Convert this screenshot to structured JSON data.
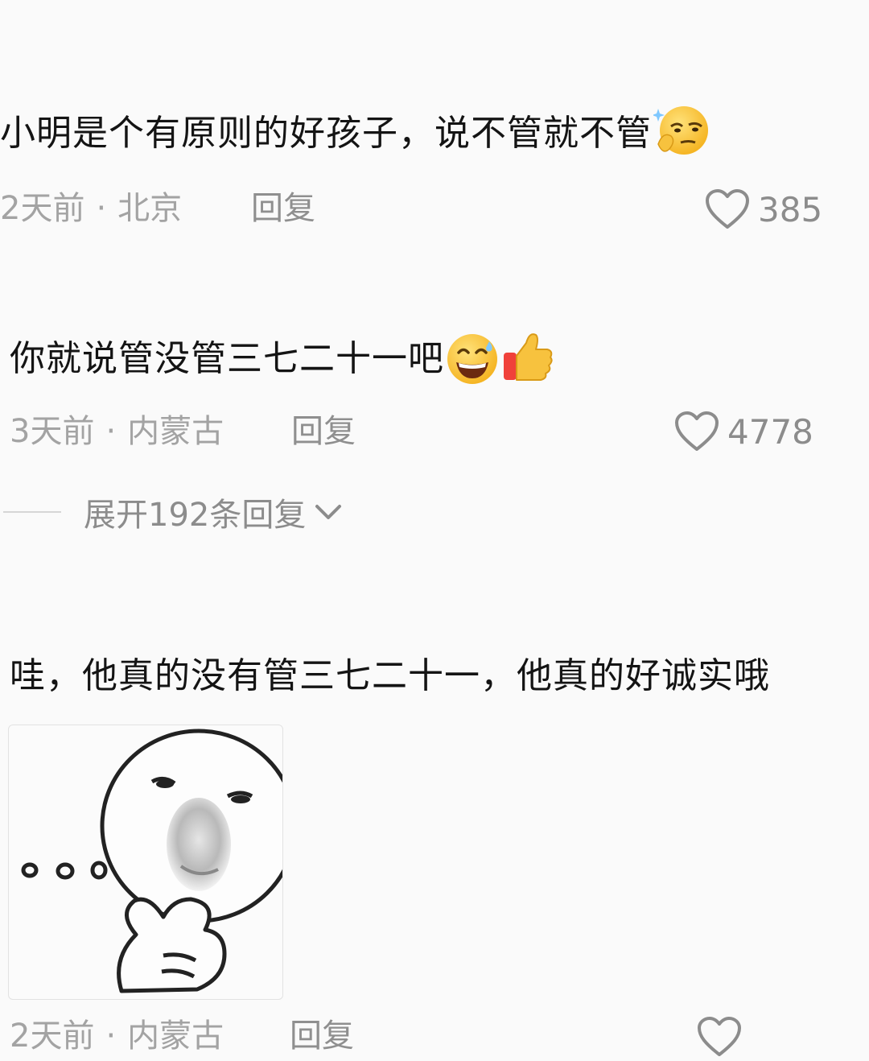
{
  "comments": [
    {
      "text": "小明是个有原则的好孩子，说不管就不管",
      "emoji": "smirk-thinking-emoji",
      "time": "2天前",
      "location": "北京",
      "reply_label": "回复",
      "likes": "385"
    },
    {
      "text": "你就说管没管三七二十一吧",
      "emojis": [
        "grinning-sweat-emoji",
        "thumbs-up-emoji"
      ],
      "time": "3天前",
      "location": "内蒙古",
      "reply_label": "回复",
      "likes": "4778",
      "expand_label": "展开192条回复"
    },
    {
      "text": "哇，他真的没有管三七二十一，他真的好诚实哦",
      "sticker": "thinking-face-meme-sticker",
      "time": "2天前",
      "location": "内蒙古",
      "reply_label": "回复"
    }
  ],
  "separator": "·",
  "icons": {
    "like": "heart-outline-icon",
    "expand": "chevron-down-icon"
  },
  "colors": {
    "background": "#fafafa",
    "text": "#141414",
    "meta": "#a3a3a3",
    "secondary": "#8c8c8c"
  }
}
